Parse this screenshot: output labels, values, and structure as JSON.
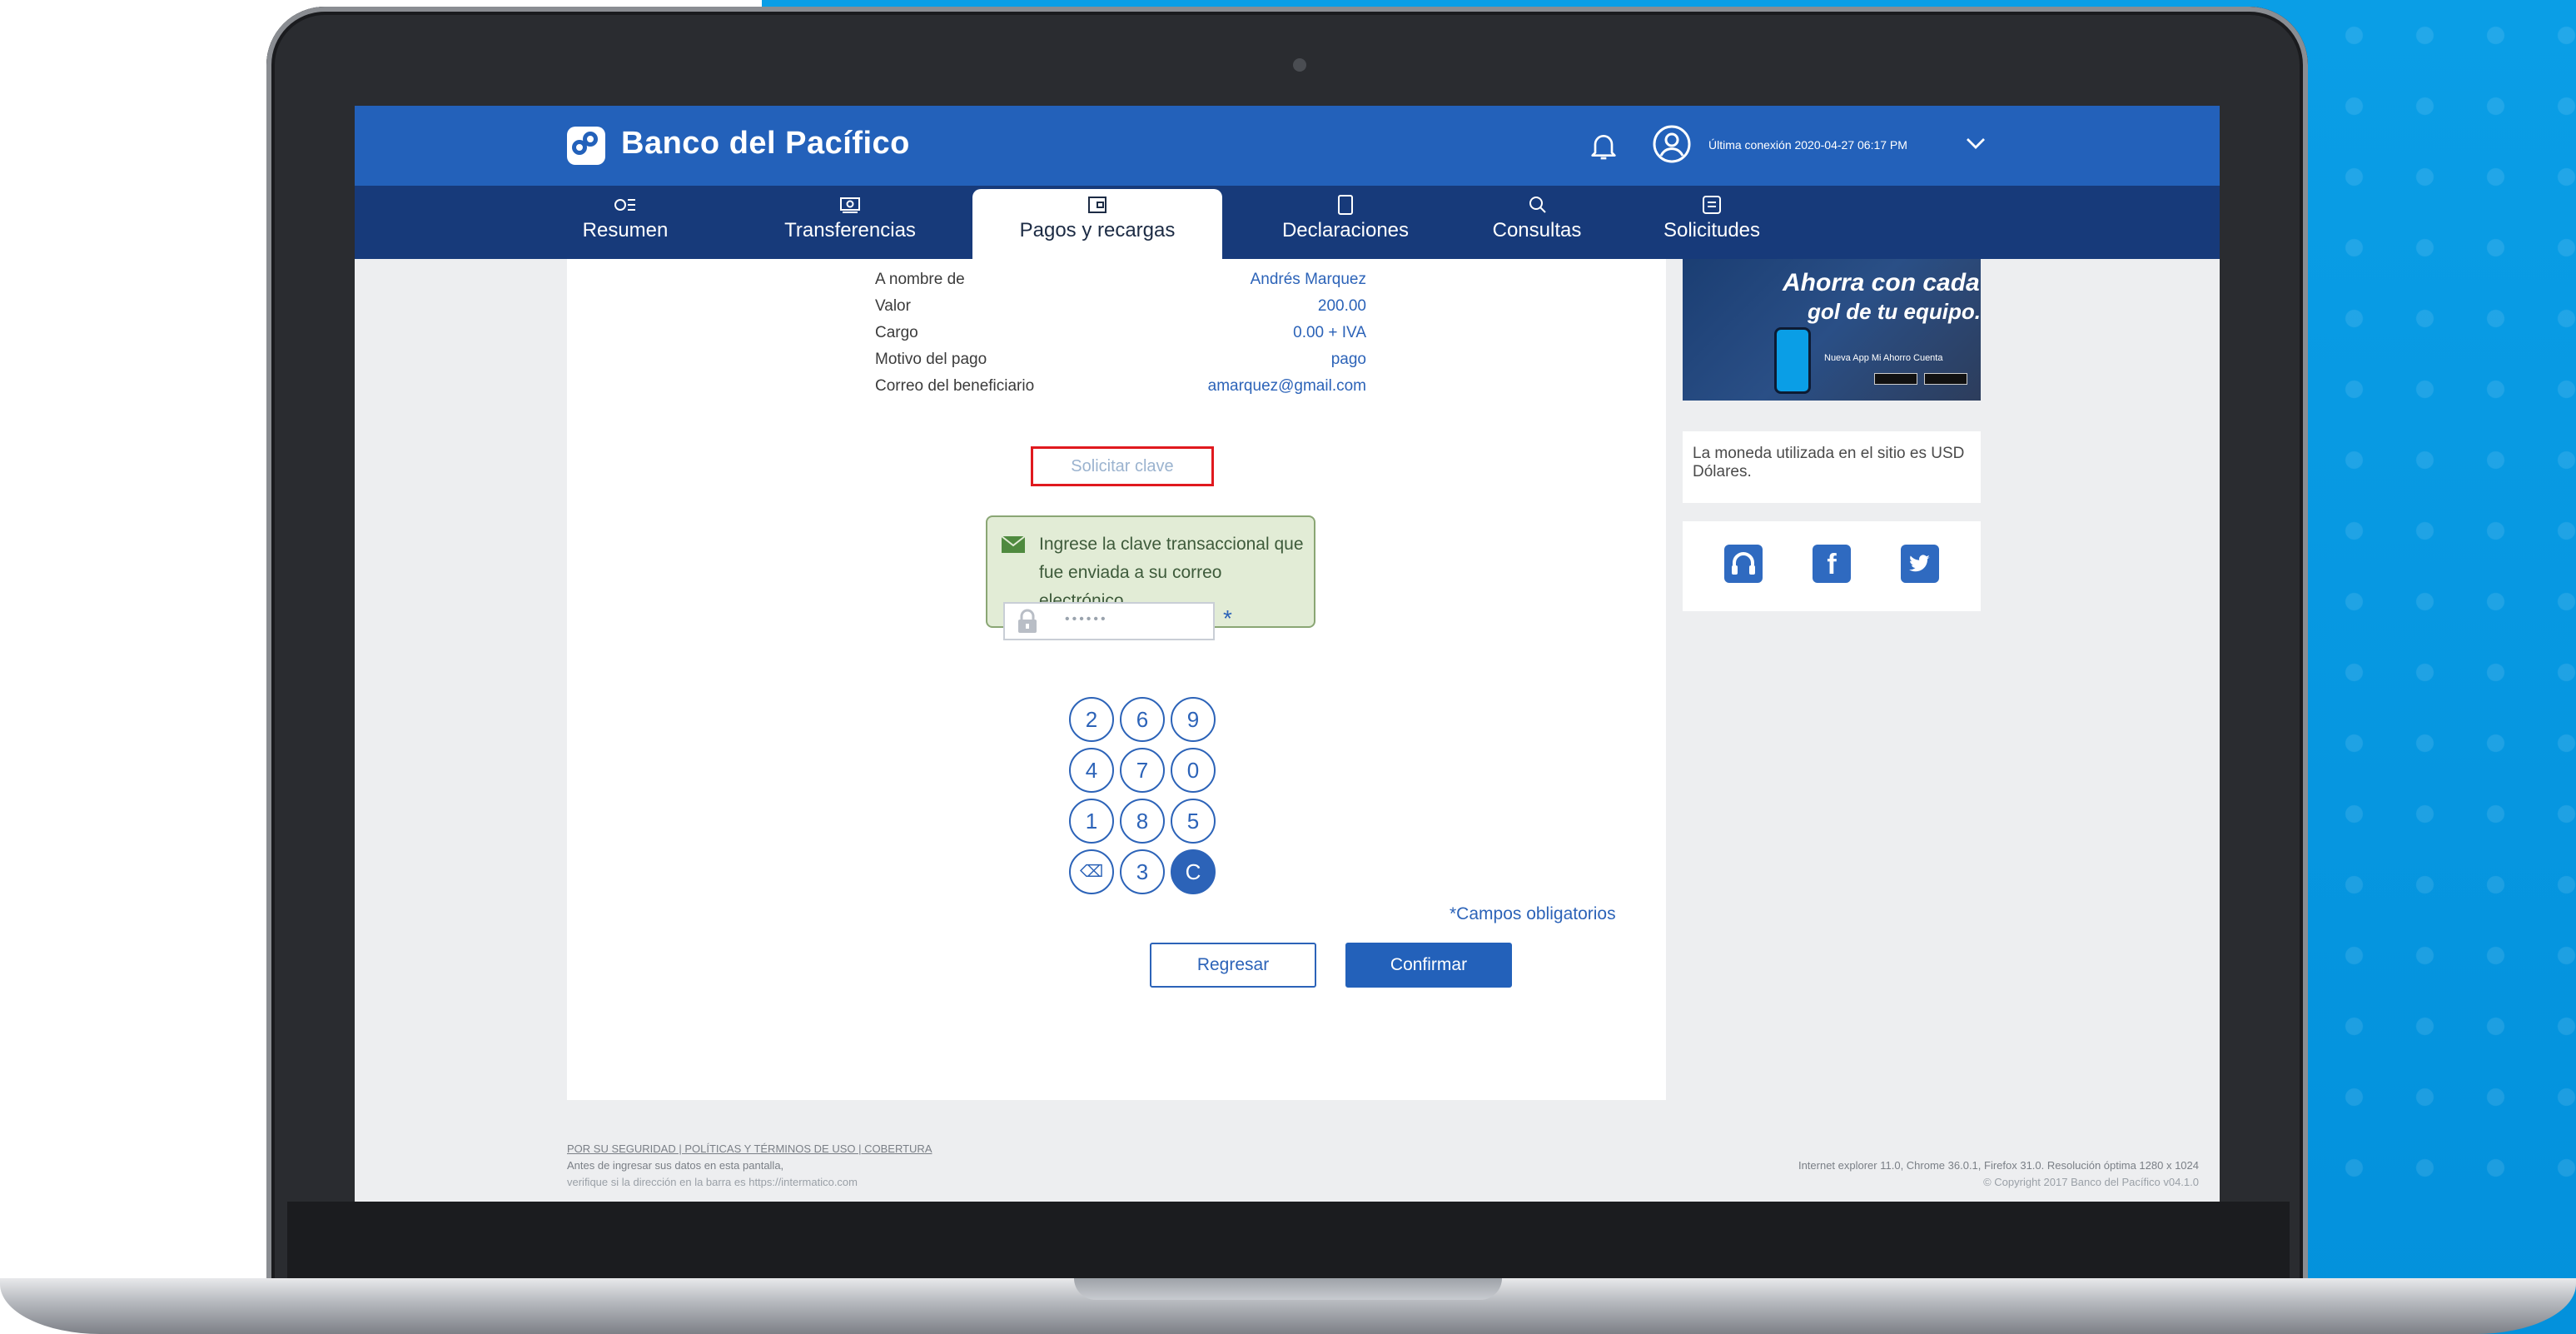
{
  "brand": {
    "name": "Banco del Pacífico",
    "primary": "#2361ba",
    "navy": "#173a7a"
  },
  "header": {
    "last_login": "Última conexión 2020-04-27 06:17 PM"
  },
  "nav": {
    "tabs": [
      {
        "label": "Resumen",
        "icon": "summary-icon"
      },
      {
        "label": "Transferencias",
        "icon": "money-icon"
      },
      {
        "label": "Pagos y recargas",
        "icon": "wallet-icon",
        "active": true
      },
      {
        "label": "Declaraciones",
        "icon": "tablet-icon"
      },
      {
        "label": "Consultas",
        "icon": "search-icon"
      },
      {
        "label": "Solicitudes",
        "icon": "request-icon"
      }
    ]
  },
  "details": [
    {
      "label": "A nombre de",
      "value": "Andrés Marquez"
    },
    {
      "label": "Valor",
      "value": "200.00"
    },
    {
      "label": "Cargo",
      "value": "0.00 + IVA"
    },
    {
      "label": "Motivo del pago",
      "value": "pago"
    },
    {
      "label": "Correo del beneficiario",
      "value": "amarquez@gmail.com"
    }
  ],
  "request_key": {
    "label": "Solicitar clave",
    "highlight_color": "#e0191e"
  },
  "info_box": {
    "text": "Ingrese la clave transaccional que fue enviada a su correo electrónico."
  },
  "password": {
    "value": "••••••",
    "required_mark": "*"
  },
  "keypad": {
    "rows": [
      [
        "2",
        "6",
        "9"
      ],
      [
        "4",
        "7",
        "0"
      ],
      [
        "1",
        "8",
        "5"
      ],
      [
        "⌫",
        "3",
        "C"
      ]
    ]
  },
  "form": {
    "mandatory_note": "*Campos obligatorios",
    "back_label": "Regresar",
    "confirm_label": "Confirmar"
  },
  "ad": {
    "title": "Ahorra con cada",
    "subtitle": "gol de tu equipo.",
    "app_text": "Nueva App Mi Ahorro Cuenta",
    "stores": [
      "App Store",
      "Google play"
    ]
  },
  "currency_note": "La moneda utilizada en el sitio es USD Dólares.",
  "social": [
    "headset-icon",
    "facebook-icon",
    "twitter-icon"
  ],
  "footer": {
    "links": "POR SU SEGURIDAD | POLÍTICAS Y TÉRMINOS DE USO | COBERTURA",
    "note": "Antes de ingresar sus datos en esta pantalla,",
    "note2": "verifique si la dirección en la barra es https://intermatico.com",
    "requirements": "Internet explorer 11.0, Chrome 36.0.1, Firefox 31.0. Resolución óptima 1280 x 1024",
    "copyright": "© Copyright 2017 Banco del Pacífico v04.1.0"
  }
}
